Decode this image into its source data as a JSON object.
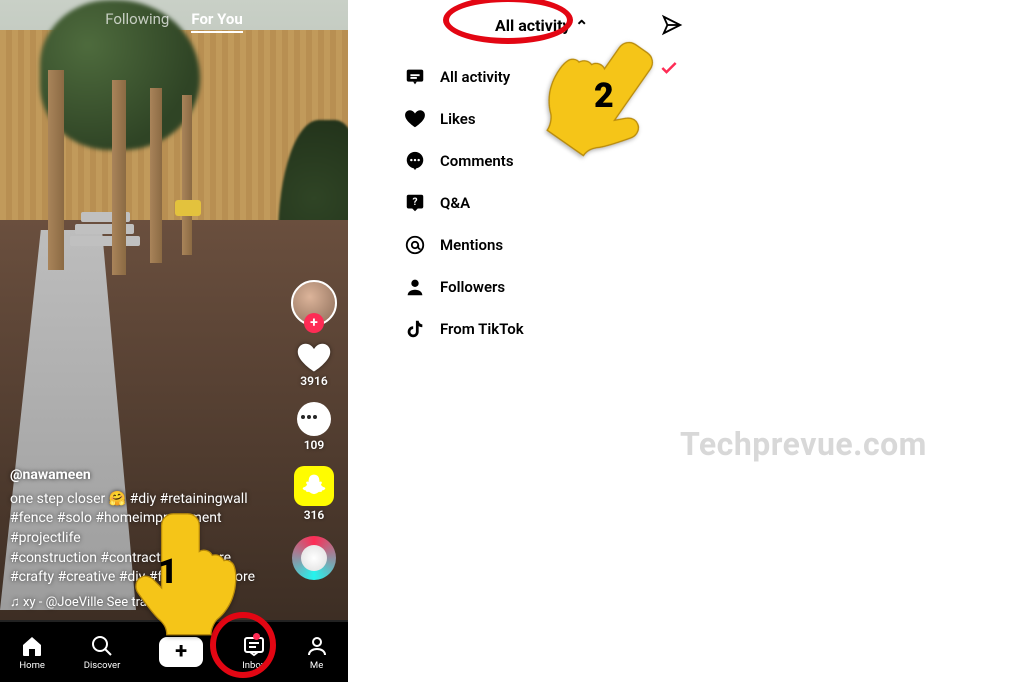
{
  "left": {
    "tabs": {
      "following": "Following",
      "forYou": "For You"
    },
    "rail": {
      "likes": "3916",
      "comments": "109",
      "shares": "316"
    },
    "caption": {
      "user": "@nawameen",
      "line1": "one step closer 🤗 #diy #retainingwall",
      "line2": "#fence #solo #homeimprovement #projectlife",
      "line3": "#construction #contractor #explore",
      "line4": "#crafty #creative #diy #foryou #explore",
      "music": "♫ xy - @JoeVille   See translation"
    },
    "nav": {
      "home": "Home",
      "discover": "Discover",
      "inbox": "Inbox",
      "me": "Me"
    }
  },
  "right": {
    "headerTitle": "All activity",
    "items": {
      "all": "All activity",
      "likes": "Likes",
      "comments": "Comments",
      "qa": "Q&A",
      "mentions": "Mentions",
      "followers": "Followers",
      "fromTiktok": "From TikTok"
    }
  },
  "annotations": {
    "step1": "1",
    "step2": "2"
  },
  "watermark": "Techprevue.com"
}
